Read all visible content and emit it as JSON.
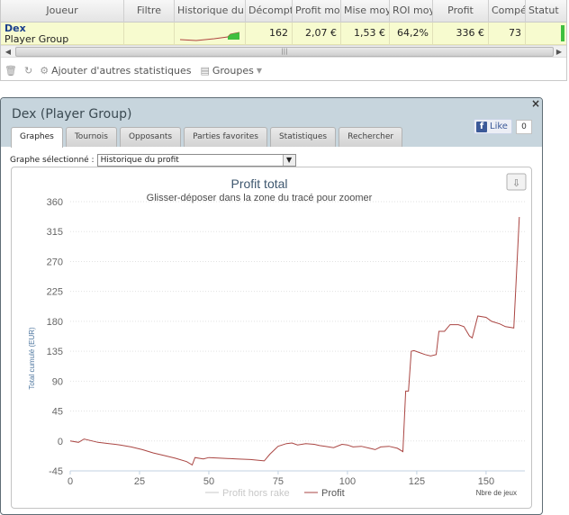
{
  "table": {
    "columns": [
      {
        "label": "Joueur",
        "w": 137
      },
      {
        "label": "Filtre",
        "w": 56
      },
      {
        "label": "Historique du p",
        "w": 79
      },
      {
        "label": "Décompte",
        "w": 52
      },
      {
        "label": "Profit moy",
        "w": 54
      },
      {
        "label": "Mise moye",
        "w": 54
      },
      {
        "label": "ROI moy",
        "w": 48
      },
      {
        "label": "Profit",
        "w": 62
      },
      {
        "label": "Compét",
        "w": 41
      },
      {
        "label": "Statut",
        "w": 45
      }
    ],
    "row": {
      "player_name": "Dex",
      "player_group": "Player Group",
      "decompte": "162",
      "profit_moy": "2,07 €",
      "mise_moy": "1,53 €",
      "roi_moy": "64,2%",
      "profit": "336 €",
      "competitions": "73"
    }
  },
  "toolbar": {
    "add_stats_label": "Ajouter d'autres statistiques",
    "groups_label": "Groupes"
  },
  "panel": {
    "title": "Dex (Player Group)",
    "close_glyph": "×",
    "like_label": "Like",
    "like_count": "0",
    "tabs": [
      "Graphes",
      "Tournois",
      "Opposants",
      "Parties favorites",
      "Statistiques",
      "Rechercher"
    ],
    "active_tab": 0,
    "graph_select_label": "Graphe sélectionné :",
    "graph_select_value": "Historique du profit"
  },
  "chart_data": {
    "type": "line",
    "title": "Profit total",
    "subtitle": "Glisser-déposer dans la zone du tracé pour zoomer",
    "ylabel": "Total cumulé (EUR)",
    "xlabel": "Nbre de jeux",
    "xlim": [
      0,
      164
    ],
    "ylim": [
      -45,
      360
    ],
    "xticks": [
      0,
      25,
      50,
      75,
      100,
      125,
      150
    ],
    "yticks": [
      -45,
      0,
      45,
      90,
      135,
      180,
      225,
      270,
      315,
      360
    ],
    "legend": [
      "Profit hors rake",
      "Profit"
    ],
    "legend_position": "bottom",
    "colors": {
      "profit": "#aa4643",
      "profit_hors_rake": "#c8c8c8"
    },
    "series": [
      {
        "name": "Profit",
        "x": [
          0,
          3,
          5,
          8,
          10,
          12,
          14,
          18,
          22,
          26,
          30,
          34,
          38,
          42,
          44,
          45,
          48,
          50,
          55,
          60,
          65,
          70,
          72,
          75,
          78,
          80,
          82,
          85,
          88,
          90,
          92,
          95,
          98,
          100,
          102,
          105,
          108,
          110,
          112,
          115,
          118,
          120,
          121,
          122,
          123,
          124,
          126,
          128,
          130,
          132,
          133,
          135,
          137,
          140,
          142,
          144,
          145,
          147,
          150,
          152,
          155,
          157,
          160,
          162
        ],
        "y": [
          0,
          -2,
          3,
          0,
          -2,
          -3,
          -4,
          -6,
          -9,
          -13,
          -18,
          -22,
          -26,
          -31,
          -36,
          -25,
          -27,
          -25,
          -26,
          -27,
          -28,
          -30,
          -20,
          -8,
          -4,
          -3,
          -6,
          -4,
          -5,
          -7,
          -8,
          -10,
          -5,
          -6,
          -9,
          -8,
          -11,
          -13,
          -9,
          -8,
          -11,
          -16,
          75,
          75,
          135,
          136,
          133,
          130,
          128,
          130,
          165,
          165,
          175,
          175,
          172,
          158,
          155,
          188,
          186,
          180,
          176,
          172,
          170,
          337
        ]
      }
    ]
  }
}
